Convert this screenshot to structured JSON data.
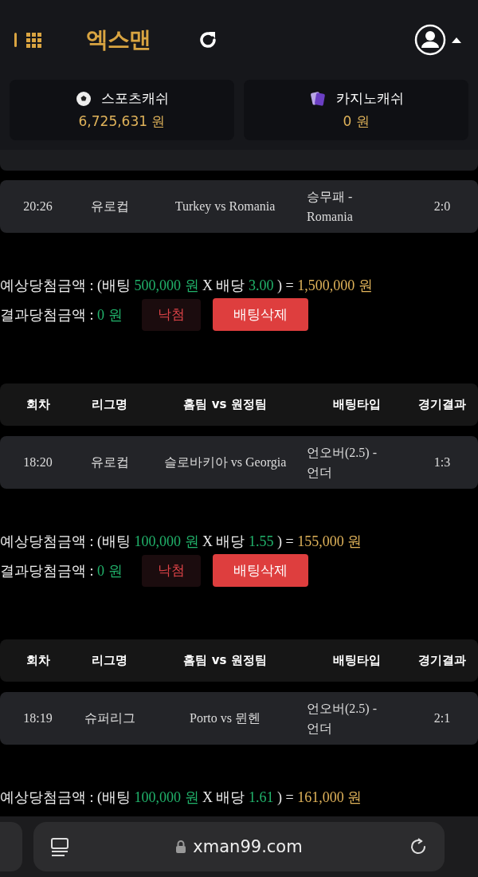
{
  "header": {
    "logo": "엑스맨"
  },
  "wallets": [
    {
      "kind": "sports",
      "label": "스포츠캐쉬",
      "amount": "6,725,631 원"
    },
    {
      "kind": "casino",
      "label": "카지노캐쉬",
      "amount": "0 원"
    }
  ],
  "bets": [
    {
      "row": {
        "time": "20:26",
        "league": "유로컵",
        "match": "Turkey vs Romania",
        "bet_type": "승무패 - Romania",
        "result": "2:0"
      },
      "expected": {
        "label": "예상당첨금액 : (배팅",
        "stake": "500,000 원",
        "times": "X 배당",
        "odds": "3.00",
        "equals": ") =",
        "payout": "1,500,000 원"
      },
      "outcome": {
        "label": "결과당첨금액 :",
        "amount": "0 원",
        "status": "낙첨",
        "delete": "배팅삭제"
      }
    },
    {
      "columns": [
        "회차",
        "리그명",
        "홈팀 vs 원정팀",
        "배팅타입",
        "경기결과"
      ],
      "row": {
        "time": "18:20",
        "league": "유로컵",
        "match": "슬로바키아 vs Georgia",
        "bet_type": "언오버(2.5) - 언더",
        "result": "1:3"
      },
      "expected": {
        "label": "예상당첨금액 : (배팅",
        "stake": "100,000 원",
        "times": "X 배당",
        "odds": "1.55",
        "equals": ") =",
        "payout": "155,000 원"
      },
      "outcome": {
        "label": "결과당첨금액 :",
        "amount": "0 원",
        "status": "낙첨",
        "delete": "배팅삭제"
      }
    },
    {
      "columns": [
        "회차",
        "리그명",
        "홈팀 vs 원정팀",
        "배팅타입",
        "경기결과"
      ],
      "row": {
        "time": "18:19",
        "league": "슈퍼리그",
        "match": "Porto vs 뮌헨",
        "bet_type": "언오버(2.5) - 언더",
        "result": "2:1"
      },
      "expected": {
        "label": "예상당첨금액 : (배팅",
        "stake": "100,000 원",
        "times": "X 배당",
        "odds": "1.61",
        "equals": ") =",
        "payout": "161,000 원"
      }
    }
  ],
  "browser": {
    "url": "xman99.com"
  }
}
